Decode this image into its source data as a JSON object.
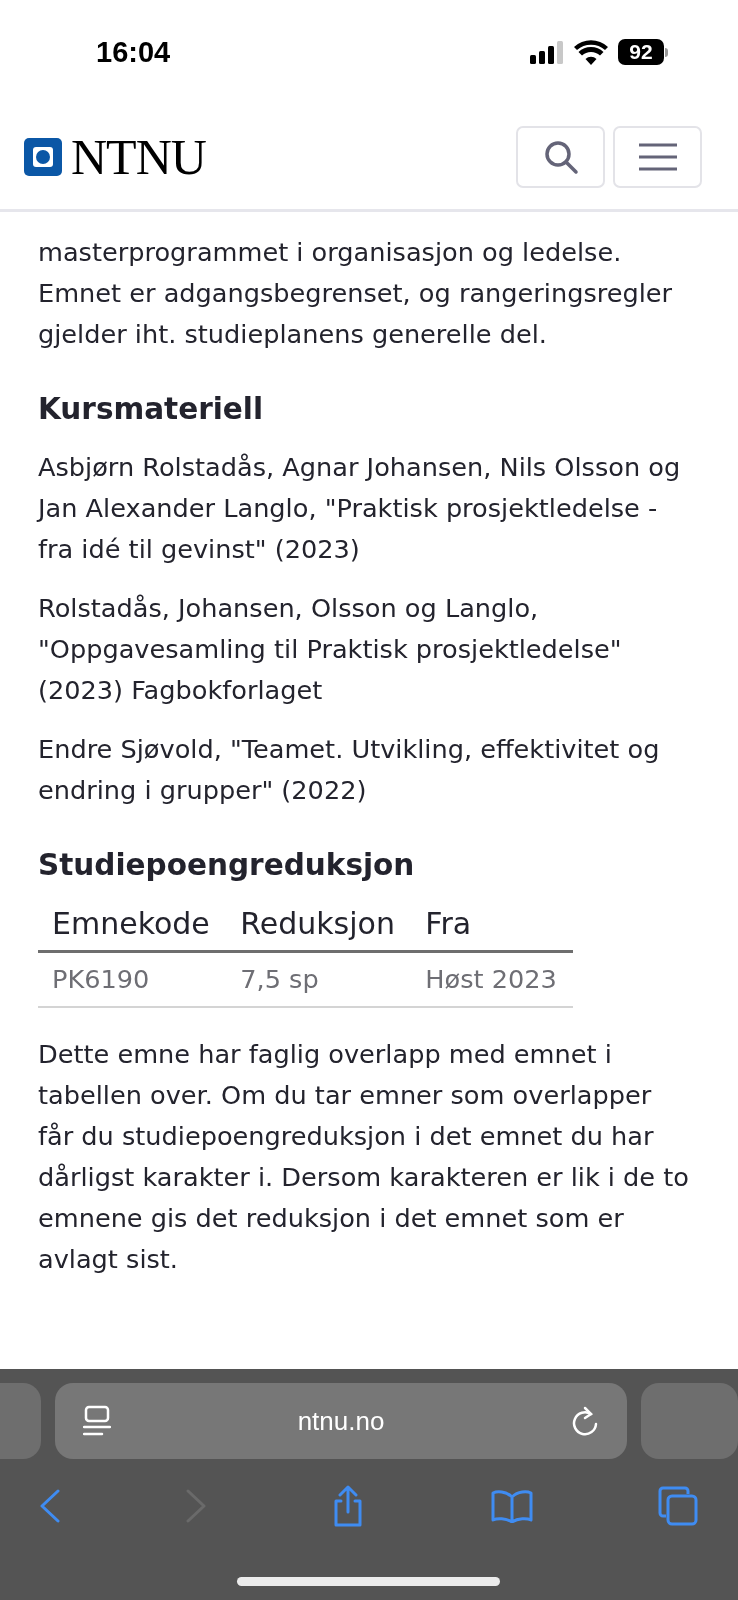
{
  "status_bar": {
    "time": "16:04",
    "battery": "92"
  },
  "header": {
    "logo": "NTNU"
  },
  "content": {
    "intro": "masterprogrammet i organisasjon og ledelse. Emnet er adgangsbegrenset, og rangeringsregler gjelder iht. studieplanens generelle del.",
    "sections": [
      {
        "heading": "Kursmateriell",
        "paragraphs": [
          "Asbjørn Rolstadås, Agnar Johansen, Nils Olsson og Jan Alexander Langlo, \"Praktisk prosjektledelse - fra idé til gevinst\" (2023)",
          "Rolstadås, Johansen, Olsson og Langlo, \"Oppgavesamling til Praktisk prosjektledelse\" (2023) Fagbokforlaget",
          "Endre Sjøvold, \"Teamet. Utvikling, effektivitet og endring i grupper\" (2022)"
        ]
      },
      {
        "heading": "Studiepoengreduksjon",
        "table": {
          "columns": [
            "Emnekode",
            "Reduksjon",
            "Fra"
          ],
          "rows": [
            [
              "PK6190",
              "7,5 sp",
              "Høst 2023"
            ]
          ]
        },
        "paragraphs": [
          "Dette emne har faglig overlapp med emnet i tabellen over. Om du tar emner som overlapper får du studiepoengreduksjon i det emnet du har dårligst karakter i. Dersom karakteren er lik i de to emnene gis det reduksjon i det emnet som er avlagt sist."
        ]
      }
    ]
  },
  "browser": {
    "url": "ntnu.no"
  }
}
